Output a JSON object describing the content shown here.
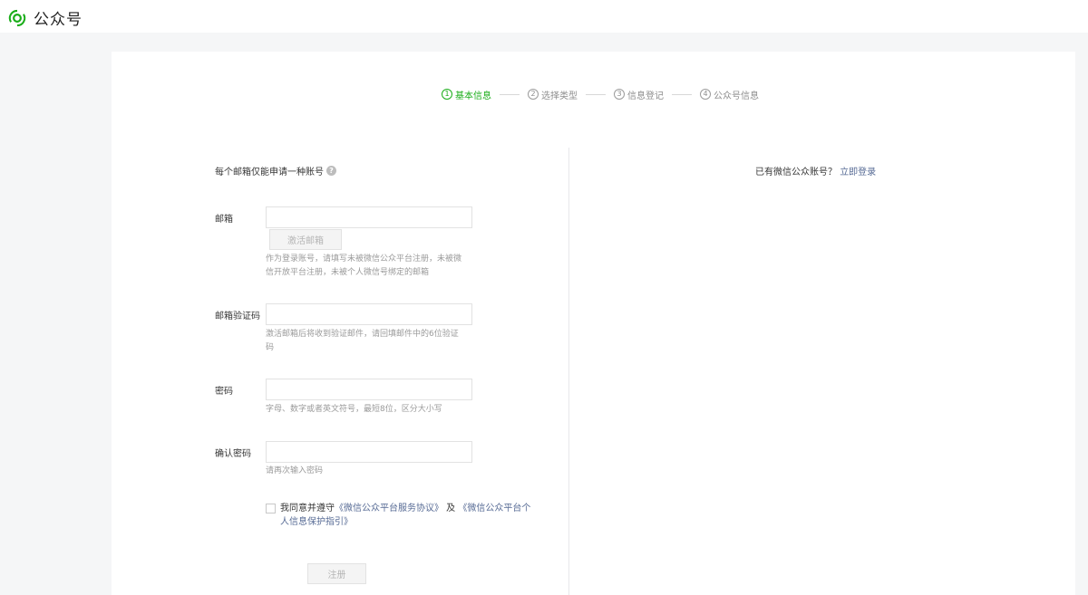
{
  "header": {
    "title": "公众号",
    "logo_icon": "wechat-mp-logo-icon"
  },
  "steps": [
    {
      "num": "1",
      "label": "基本信息",
      "active": true
    },
    {
      "num": "2",
      "label": "选择类型",
      "active": false
    },
    {
      "num": "3",
      "label": "信息登记",
      "active": false
    },
    {
      "num": "4",
      "label": "公众号信息",
      "active": false
    }
  ],
  "form": {
    "intro": "每个邮箱仅能申请一种账号",
    "intro_icon": "question-icon",
    "email": {
      "label": "邮箱",
      "value": "",
      "placeholder": "",
      "activate_button": "激活邮箱",
      "hint": "作为登录账号，请填写未被微信公众平台注册，未被微信开放平台注册，未被个人微信号绑定的邮箱"
    },
    "code": {
      "label": "邮箱验证码",
      "value": "",
      "hint": "激活邮箱后将收到验证邮件，请回填邮件中的6位验证码"
    },
    "password": {
      "label": "密码",
      "value": "",
      "hint": "字母、数字或者英文符号，最短8位，区分大小写"
    },
    "confirm": {
      "label": "确认密码",
      "value": "",
      "hint": "请再次输入密码"
    },
    "agree": {
      "prefix": "我同意并遵守",
      "link1": "《微信公众平台服务协议》",
      "mid": " 及 ",
      "link2": "《微信公众平台个人信息保护指引》",
      "checked": false
    },
    "register_button": "注册"
  },
  "side": {
    "prompt": "已有微信公众账号？",
    "login_link": "立即登录"
  },
  "colors": {
    "accent": "#1aad19",
    "link": "#576b95"
  }
}
